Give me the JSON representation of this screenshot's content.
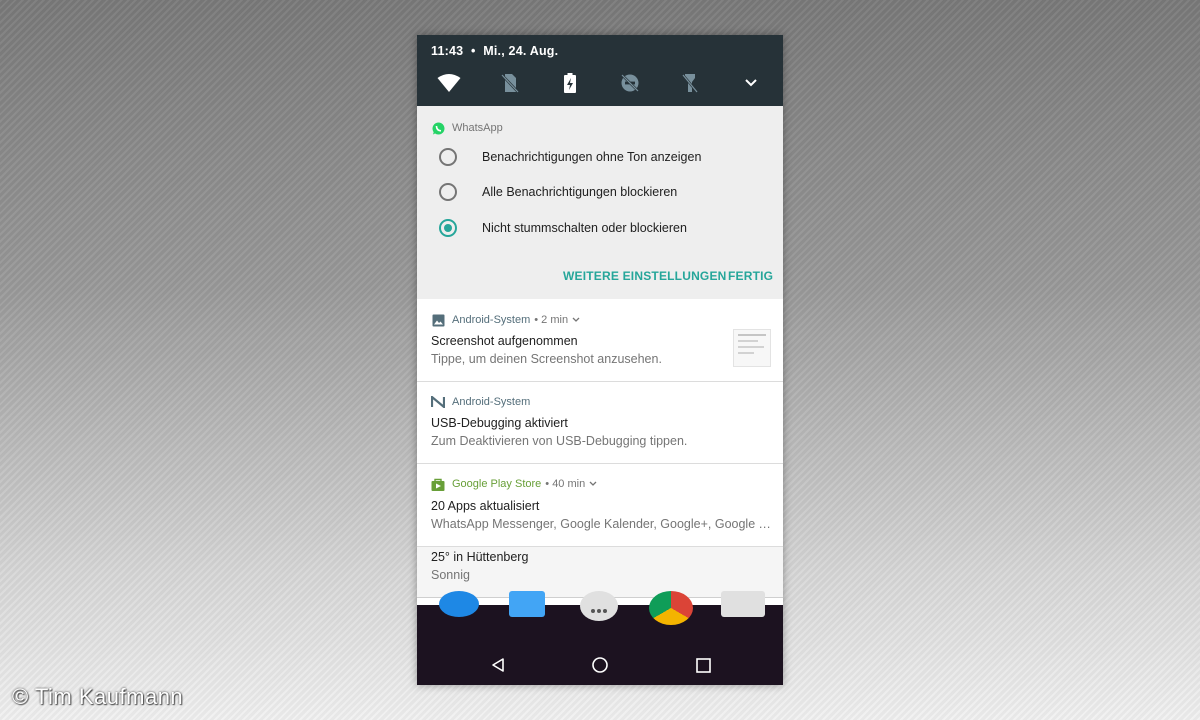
{
  "status": {
    "time": "11:43",
    "separator": "•",
    "date": "Mi., 24. Aug."
  },
  "quick_settings": {
    "icons": [
      "wifi-icon",
      "sim-off-icon",
      "battery-charging-icon",
      "do-not-disturb-off-icon",
      "flashlight-off-icon",
      "expand-icon"
    ]
  },
  "whatsapp_card": {
    "app_name": "WhatsApp",
    "options": [
      {
        "label": "Benachrichtigungen ohne Ton anzeigen",
        "selected": false
      },
      {
        "label": "Alle Benachrichtigungen blockieren",
        "selected": false
      },
      {
        "label": "Nicht stummschalten oder blockieren",
        "selected": true
      }
    ],
    "more_settings_label": "WEITERE EINSTELLUNGEN",
    "done_label": "FERTIG",
    "accent_color": "#26a69a"
  },
  "notifications": [
    {
      "app": "Android-System",
      "meta": "• 2 min",
      "title": "Screenshot aufgenommen",
      "text": "Tippe, um deinen Screenshot anzusehen.",
      "icon": "image-icon",
      "app_color": "#546e7a"
    },
    {
      "app": "Android-System",
      "meta": "",
      "title": "USB-Debugging aktiviert",
      "text": "Zum Deaktivieren von USB-Debugging tippen.",
      "icon": "android-n-icon",
      "app_color": "#546e7a"
    },
    {
      "app": "Google Play Store",
      "meta": "• 40 min",
      "title": "20 Apps aktualisiert",
      "text": "WhatsApp Messenger, Google Kalender, Google+, Google Ta...",
      "icon": "play-store-icon",
      "app_color": "#689f38"
    }
  ],
  "weather": {
    "title": "25° in Hüttenberg",
    "text": "Sonnig"
  },
  "navigation": [
    "back-icon",
    "home-icon",
    "recents-icon"
  ],
  "watermark": "© Tim Kaufmann"
}
